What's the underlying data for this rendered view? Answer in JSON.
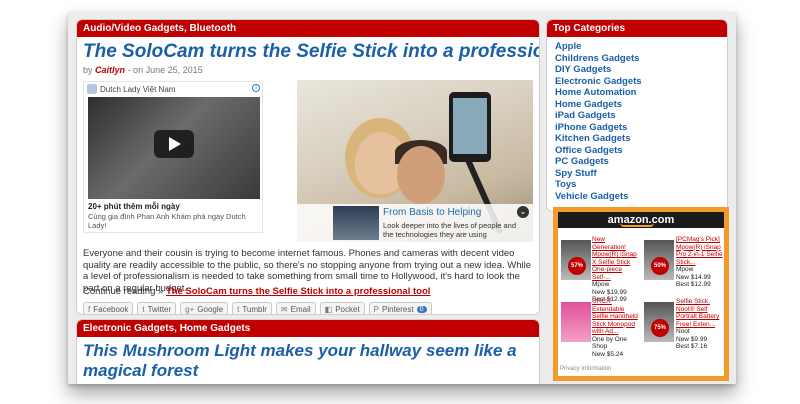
{
  "article1": {
    "category": "Audio/Video Gadgets, Bluetooth",
    "title": "The SoloCam turns the Selfie Stick into a professional tool",
    "by": "by",
    "author": "Caitlyn",
    "date": "- on June 25, 2015",
    "body": "Everyone and their cousin is trying to become internet famous. Phones and cameras with decent video quality are readily accessible to the public, so there's no stopping anyone from trying out a new idea. While a level of professionalism is needed to take something from small time to Hollywood, it's hard to look the part on a regular budget.",
    "continue_prefix": "Continue reading »",
    "continue_link": "The SoloCam turns the Selfie Stick into a professional tool"
  },
  "ad": {
    "advertiser": "Dutch Lady Việt Nam",
    "info": "i",
    "title": "20+ phút thêm mỗi ngày",
    "desc": "Cùng gia đình Phan Anh Khám phá ngay Dutch Lady!"
  },
  "hero_overlay": {
    "title": "From Basis to Helping",
    "desc": "Look deeper into the lives of people and the technologies they are using",
    "chevron": "⌄"
  },
  "share": [
    {
      "icon": "f",
      "label": "Facebook"
    },
    {
      "icon": "t",
      "label": "Twitter"
    },
    {
      "icon": "g+",
      "label": "Google"
    },
    {
      "icon": "t",
      "label": "Tumblr"
    },
    {
      "icon": "✉",
      "label": "Email"
    },
    {
      "icon": "◧",
      "label": "Pocket"
    },
    {
      "icon": "P",
      "label": "Pinterest",
      "count": "0"
    }
  ],
  "article2": {
    "category": "Electronic Gadgets, Home Gadgets",
    "title": "This Mushroom Light makes your hallway seem like a magical forest"
  },
  "sidebar": {
    "title": "Top Categories",
    "items": [
      "Apple",
      "Childrens Gadgets",
      "DIY Gadgets",
      "Electronic Gadgets",
      "Home Automation",
      "Home Gadgets",
      "iPad Gadgets",
      "iPhone Gadgets",
      "Kitchen Gadgets",
      "Office Gadgets",
      "PC Gadgets",
      "Spy Stuff",
      "Toys",
      "Vehicle Gadgets"
    ]
  },
  "amazon": {
    "logo": "amazon.com",
    "products": [
      {
        "title": "New Generation! Mpow(R) iSnap X Selfie Stick One-piece Self-...",
        "maker": "Mpow",
        "new": "New $19.99",
        "best": "Best $12.99",
        "discount": "57% off"
      },
      {
        "title": "[PCMag's Pick] Mpow(R) iSnap Pro 2-in-1 Selfie Stick...",
        "maker": "Mpow",
        "new": "New $14.99",
        "best": "Best $12.99",
        "discount": "50% off"
      },
      {
        "title": "URCIT Extendable Selfie Handheld Stick Monopod with Ad...",
        "maker": "One by One Shop",
        "new": "New $5.24",
        "best": "",
        "discount": ""
      },
      {
        "title": "Selfie Stick, Noot® Self Portrait Battery Free! Exten...",
        "maker": "Noot",
        "new": "New $9.99",
        "best": "Best $7.16",
        "discount": "75% off"
      }
    ],
    "footer": "Privacy Information"
  }
}
